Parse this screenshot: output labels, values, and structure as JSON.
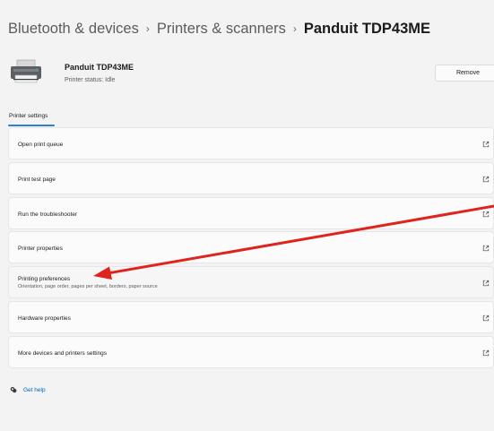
{
  "breadcrumb": {
    "items": [
      "Bluetooth & devices",
      "Printers & scanners",
      "Panduit TDP43ME"
    ],
    "separator": "›"
  },
  "printer": {
    "name": "Panduit TDP43ME",
    "status": "Printer status:  Idle",
    "icon": "printer-icon"
  },
  "remove_label": "Remove",
  "tab_label": "Printer settings",
  "settings": [
    {
      "title": "Open print queue",
      "icon": "external-link-icon"
    },
    {
      "title": "Print test page",
      "icon": "external-link-icon"
    },
    {
      "title": "Run the troubleshooter",
      "icon": "external-link-icon"
    },
    {
      "title": "Printer properties",
      "icon": "external-link-icon"
    },
    {
      "title": "Printing preferences",
      "subtitle": "Orientation, page order, pages per sheet, borders, paper source",
      "icon": "external-link-icon"
    },
    {
      "title": "Hardware properties",
      "icon": "external-link-icon"
    },
    {
      "title": "More devices and printers settings",
      "icon": "external-link-icon"
    }
  ],
  "help_label": "Get help",
  "colors": {
    "accent": "#2f7ed1",
    "link": "#005fb8",
    "annotation_arrow": "#e0231d"
  }
}
